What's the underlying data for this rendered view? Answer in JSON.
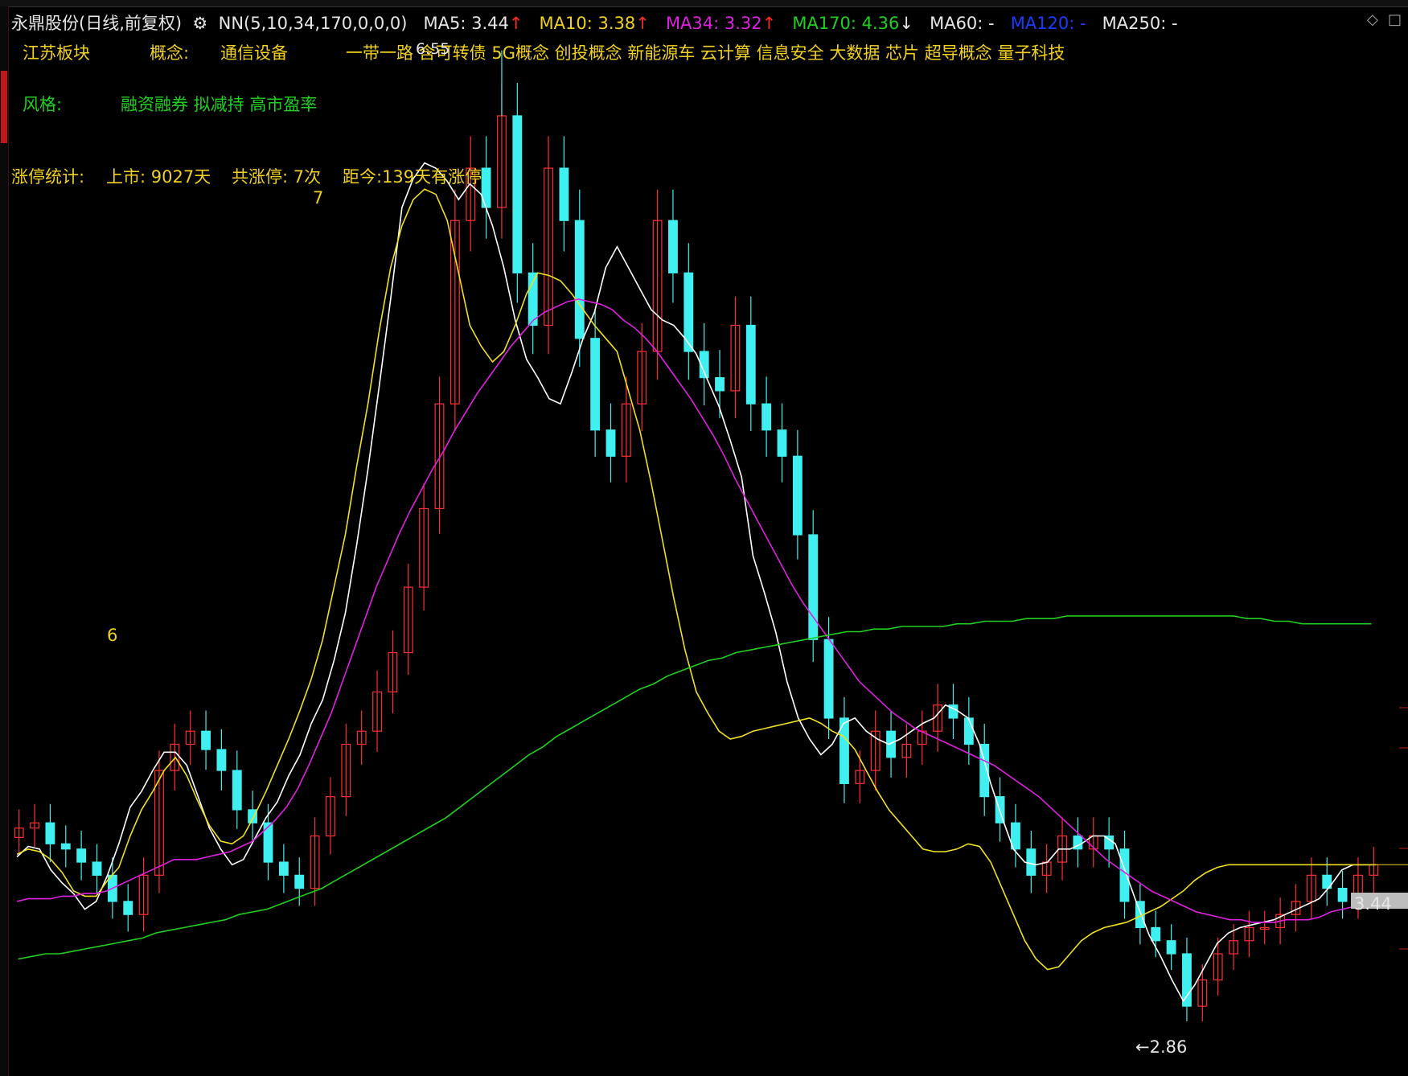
{
  "header": {
    "stock_name": "永鼎股份(日线,前复权)",
    "indicator": "NN(5,10,34,170,0,0,0)",
    "ma5": "MA5: 3.44",
    "ma10": "MA10: 3.38",
    "ma34": "MA34: 3.32",
    "ma170": "MA170: 4.36",
    "ma60": "MA60: -",
    "ma120": "MA120: -",
    "ma250": "MA250: -",
    "up_arrow": "↑",
    "down_arrow": "↓"
  },
  "info": {
    "region": "江苏板块",
    "concept_label": "概念:",
    "concept_main": "通信设备",
    "concepts": "一带一路 含可转债 5G概念 创投概念 新能源车 云计算 信息安全 大数据 芯片 超导概念 量子科技",
    "style_label": "风格:",
    "styles": "融资融券 拟减持 高市盈率",
    "limit_label": "涨停统计:",
    "listed": "上市: 9027天",
    "total_limit": "共涨停: 7次",
    "since": "距今:139天有涨停"
  },
  "annotations": {
    "marker_6": "6",
    "marker_7": "7",
    "high_label": "6.55",
    "low_label": "←2.86",
    "last_price": "3.44"
  },
  "colors": {
    "up": "#ff3030",
    "down": "#40f0f0",
    "ma5": "#ffffff",
    "ma10": "#f0e020",
    "ma34": "#e020e0",
    "ma170": "#20d020"
  },
  "chart_data": {
    "type": "candlestick",
    "title": "永鼎股份(日线,前复权)",
    "ylim": [
      2.75,
      6.65
    ],
    "series": [
      {
        "name": "MA5",
        "values": [
          3.47,
          3.51,
          3.5,
          3.42,
          3.37,
          3.33,
          3.27,
          3.3,
          3.4,
          3.52,
          3.66,
          3.72,
          3.8,
          3.87,
          3.87,
          3.82,
          3.7,
          3.58,
          3.5,
          3.44,
          3.46,
          3.54,
          3.62,
          3.68,
          3.78,
          3.86,
          3.98,
          4.07,
          4.22,
          4.4,
          4.66,
          4.95,
          5.27,
          5.6,
          5.95,
          6.06,
          6.12,
          6.1,
          6.05,
          5.98,
          6.04,
          6.0,
          5.88,
          5.72,
          5.52,
          5.37,
          5.3,
          5.22,
          5.2,
          5.32,
          5.45,
          5.55,
          5.72,
          5.8,
          5.72,
          5.64,
          5.56,
          5.52,
          5.5,
          5.45,
          5.39,
          5.29,
          5.19,
          5.06,
          4.92,
          4.62,
          4.48,
          4.33,
          4.14,
          4.0,
          3.92,
          3.86,
          3.9,
          3.98,
          4.0,
          3.95,
          3.92,
          3.9,
          3.92,
          3.95,
          3.98,
          4.0,
          4.05,
          4.03,
          4.0,
          3.9,
          3.75,
          3.62,
          3.5,
          3.45,
          3.44,
          3.45,
          3.5,
          3.5,
          3.52,
          3.55,
          3.55,
          3.52,
          3.4,
          3.28,
          3.17,
          3.09,
          3.0,
          2.92,
          2.98,
          3.06,
          3.14,
          3.18,
          3.2,
          3.21,
          3.22,
          3.23,
          3.25,
          3.27,
          3.29,
          3.31,
          3.36,
          3.42,
          3.44,
          3.44,
          3.44
        ]
      },
      {
        "name": "MA10",
        "values": [
          3.48,
          3.5,
          3.49,
          3.46,
          3.41,
          3.34,
          3.32,
          3.32,
          3.38,
          3.43,
          3.55,
          3.65,
          3.72,
          3.8,
          3.85,
          3.78,
          3.68,
          3.59,
          3.53,
          3.52,
          3.55,
          3.63,
          3.72,
          3.82,
          3.92,
          4.03,
          4.15,
          4.3,
          4.5,
          4.7,
          4.96,
          5.2,
          5.48,
          5.72,
          5.88,
          5.98,
          6.02,
          6.0,
          5.9,
          5.7,
          5.5,
          5.42,
          5.36,
          5.4,
          5.5,
          5.62,
          5.7,
          5.69,
          5.67,
          5.62,
          5.56,
          5.5,
          5.45,
          5.4,
          5.25,
          5.1,
          4.9,
          4.68,
          4.46,
          4.26,
          4.1,
          4.02,
          3.95,
          3.92,
          3.93,
          3.95,
          3.96,
          3.97,
          3.98,
          3.99,
          4.0,
          3.98,
          3.95,
          3.93,
          3.88,
          3.8,
          3.72,
          3.65,
          3.6,
          3.55,
          3.5,
          3.49,
          3.49,
          3.5,
          3.52,
          3.51,
          3.45,
          3.35,
          3.25,
          3.15,
          3.08,
          3.04,
          3.05,
          3.1,
          3.15,
          3.18,
          3.2,
          3.21,
          3.22,
          3.24,
          3.26,
          3.28,
          3.31,
          3.34,
          3.38,
          3.41,
          3.43,
          3.44,
          3.44,
          3.44,
          3.44,
          3.44,
          3.44,
          3.44,
          3.44,
          3.44,
          3.44,
          3.44,
          3.44,
          3.44,
          3.44
        ]
      },
      {
        "name": "MA34",
        "values": [
          3.3,
          3.31,
          3.31,
          3.31,
          3.32,
          3.32,
          3.33,
          3.33,
          3.34,
          3.36,
          3.38,
          3.4,
          3.42,
          3.44,
          3.46,
          3.46,
          3.46,
          3.47,
          3.48,
          3.49,
          3.51,
          3.53,
          3.57,
          3.61,
          3.66,
          3.73,
          3.82,
          3.92,
          4.02,
          4.14,
          4.26,
          4.38,
          4.5,
          4.6,
          4.7,
          4.79,
          4.87,
          4.95,
          5.02,
          5.1,
          5.17,
          5.24,
          5.3,
          5.36,
          5.42,
          5.47,
          5.52,
          5.55,
          5.57,
          5.59,
          5.6,
          5.59,
          5.58,
          5.56,
          5.52,
          5.49,
          5.45,
          5.4,
          5.34,
          5.28,
          5.22,
          5.15,
          5.08,
          5.0,
          4.91,
          4.83,
          4.75,
          4.67,
          4.59,
          4.51,
          4.44,
          4.38,
          4.32,
          4.26,
          4.2,
          4.14,
          4.1,
          4.06,
          4.02,
          3.99,
          3.96,
          3.94,
          3.92,
          3.9,
          3.88,
          3.86,
          3.84,
          3.82,
          3.79,
          3.76,
          3.73,
          3.7,
          3.66,
          3.62,
          3.58,
          3.54,
          3.5,
          3.46,
          3.43,
          3.4,
          3.37,
          3.34,
          3.32,
          3.3,
          3.28,
          3.26,
          3.25,
          3.24,
          3.23,
          3.23,
          3.22,
          3.22,
          3.22,
          3.23,
          3.23,
          3.23,
          3.24,
          3.26,
          3.27,
          3.28,
          3.3,
          3.32
        ]
      },
      {
        "name": "MA170",
        "values": [
          3.08,
          3.09,
          3.1,
          3.1,
          3.11,
          3.12,
          3.13,
          3.14,
          3.15,
          3.16,
          3.18,
          3.19,
          3.2,
          3.21,
          3.22,
          3.23,
          3.25,
          3.26,
          3.27,
          3.29,
          3.31,
          3.33,
          3.35,
          3.38,
          3.41,
          3.44,
          3.47,
          3.5,
          3.53,
          3.56,
          3.59,
          3.62,
          3.66,
          3.7,
          3.74,
          3.78,
          3.82,
          3.86,
          3.89,
          3.93,
          3.96,
          3.99,
          4.02,
          4.05,
          4.08,
          4.11,
          4.13,
          4.16,
          4.18,
          4.2,
          4.22,
          4.23,
          4.25,
          4.26,
          4.27,
          4.28,
          4.29,
          4.3,
          4.31,
          4.32,
          4.33,
          4.33,
          4.34,
          4.34,
          4.35,
          4.35,
          4.35,
          4.35,
          4.36,
          4.36,
          4.37,
          4.37,
          4.37,
          4.38,
          4.38,
          4.38,
          4.39,
          4.39,
          4.39,
          4.39,
          4.39,
          4.39,
          4.39,
          4.39,
          4.39,
          4.39,
          4.39,
          4.39,
          4.39,
          4.38,
          4.38,
          4.37,
          4.37,
          4.36,
          4.36,
          4.36,
          4.36,
          4.36,
          4.36
        ]
      },
      {
        "name": "price",
        "values": [
          3.58,
          3.6,
          3.52,
          3.5,
          3.45,
          3.4,
          3.3,
          3.25,
          3.4,
          3.8,
          3.9,
          3.95,
          3.88,
          3.8,
          3.65,
          3.6,
          3.45,
          3.4,
          3.35,
          3.55,
          3.7,
          3.9,
          3.95,
          4.1,
          4.25,
          4.5,
          4.8,
          5.2,
          5.9,
          6.1,
          5.95,
          6.3,
          5.7,
          5.5,
          6.1,
          5.9,
          5.45,
          5.1,
          5.0,
          5.2,
          5.4,
          5.9,
          5.7,
          5.4,
          5.3,
          5.25,
          5.5,
          5.2,
          5.1,
          5.0,
          4.7,
          4.3,
          4.0,
          3.75,
          3.8,
          3.95,
          3.85,
          3.9,
          3.95,
          4.05,
          4.0,
          3.9,
          3.7,
          3.6,
          3.5,
          3.4,
          3.45,
          3.55,
          3.5,
          3.55,
          3.5,
          3.3,
          3.2,
          3.15,
          3.1,
          2.9,
          3.0,
          3.1,
          3.15,
          3.2,
          3.2,
          3.25,
          3.3,
          3.4,
          3.35,
          3.3,
          3.4,
          3.44
        ]
      }
    ],
    "high": 6.55,
    "low": 2.86,
    "last": 3.44
  }
}
